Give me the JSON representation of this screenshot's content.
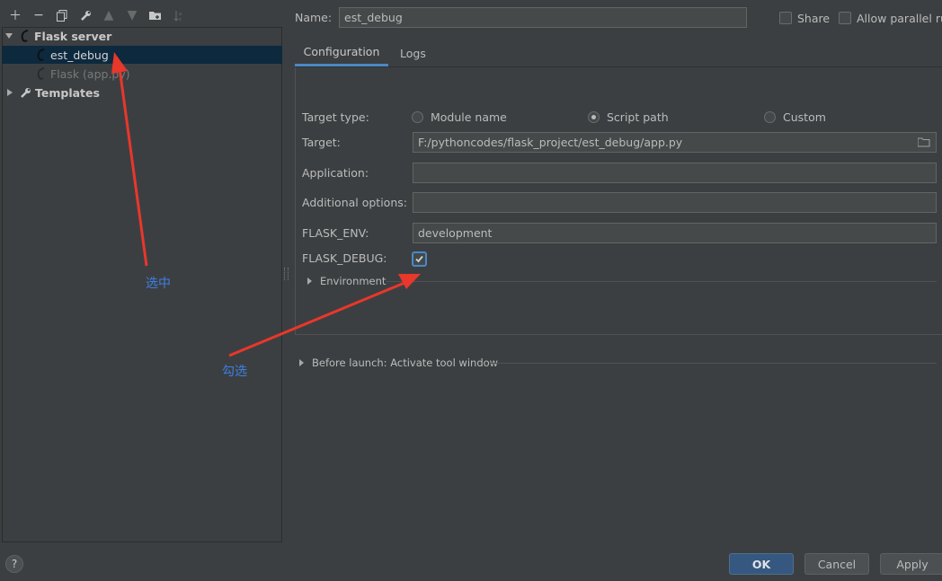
{
  "toolbar": {
    "icons": [
      "plus-icon",
      "minus-icon",
      "copy-icon",
      "wrench-icon",
      "arrow-up-icon",
      "arrow-down-icon",
      "folder-add-icon",
      "sort-icon"
    ]
  },
  "tree": {
    "group": "Flask server",
    "items": [
      {
        "label": "est_debug",
        "selected": true
      },
      {
        "label": "Flask (app.py)",
        "selected": false,
        "dimmed": true
      }
    ],
    "templates": "Templates"
  },
  "header": {
    "name_label": "Name:",
    "name_value": "est_debug",
    "share_label": "Share",
    "parallel_label": "Allow parallel ru"
  },
  "tabs": [
    "Configuration",
    "Logs"
  ],
  "form": {
    "target_type_label": "Target type:",
    "radio_module": "Module name",
    "radio_script": "Script path",
    "radio_custom": "Custom",
    "target_label": "Target:",
    "target_value": "F:/pythoncodes/flask_project/est_debug/app.py",
    "application_label": "Application:",
    "application_value": "",
    "additional_label": "Additional options:",
    "additional_value": "",
    "flask_env_label": "FLASK_ENV:",
    "flask_env_value": "development",
    "flask_debug_label": "FLASK_DEBUG:",
    "flask_debug_checked": true,
    "environment_label": "Environment"
  },
  "before_launch": "Before launch: Activate tool window",
  "buttons": {
    "ok": "OK",
    "cancel": "Cancel",
    "apply": "Apply",
    "help": "?"
  },
  "annotations": {
    "select": "选中",
    "check": "勾选"
  },
  "colors": {
    "accent": "#4a88c7",
    "annotation_arrow": "#e8372b",
    "annotation_text": "#3d7fe3"
  }
}
